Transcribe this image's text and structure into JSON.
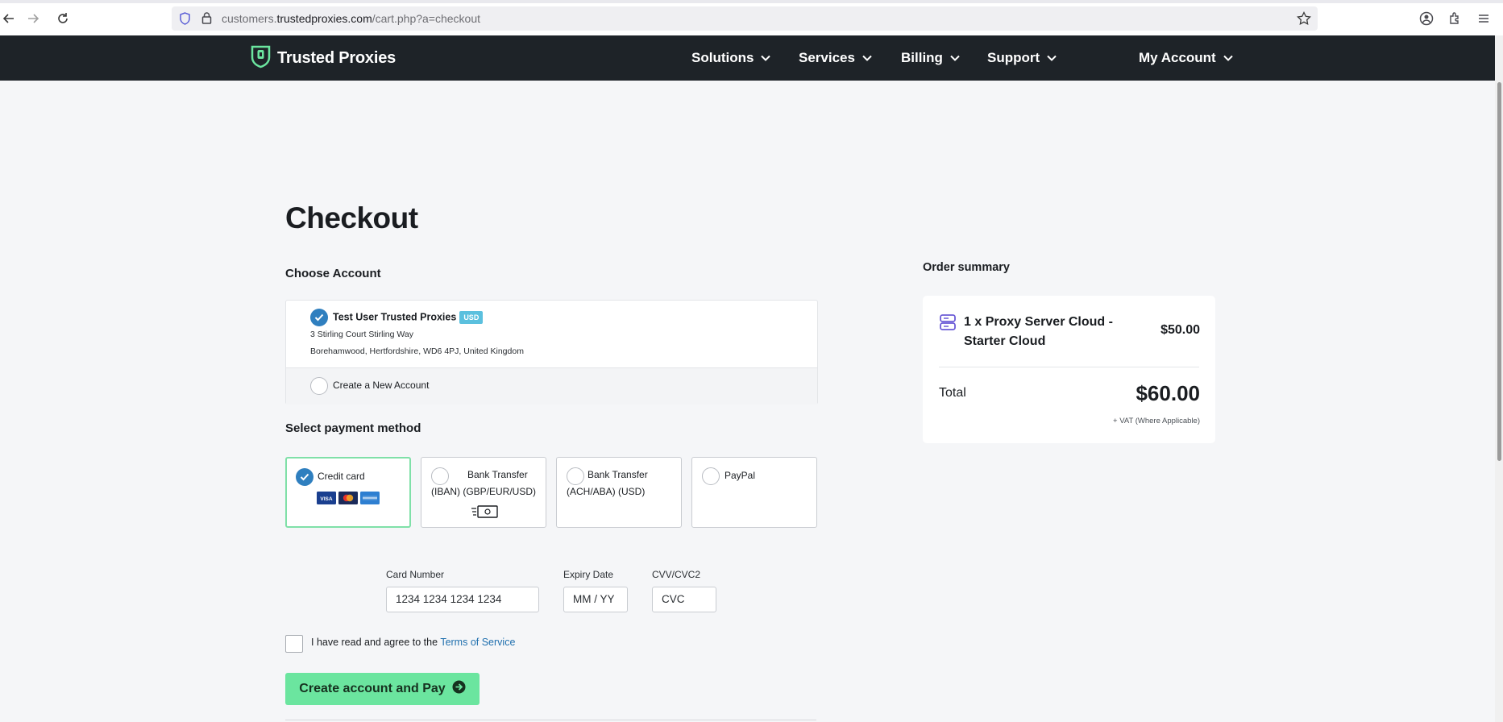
{
  "browser": {
    "url_host_prefix": "customers.",
    "url_host": "trustedproxies.com",
    "url_path": "/cart.php?a=checkout"
  },
  "header": {
    "logo_text": "Trusted Proxies",
    "nav": [
      {
        "label": "Solutions"
      },
      {
        "label": "Services"
      },
      {
        "label": "Billing"
      },
      {
        "label": "Support"
      },
      {
        "label": "My Account"
      }
    ]
  },
  "checkout": {
    "title": "Checkout",
    "choose_account_title": "Choose Account",
    "account": {
      "name": "Test User Trusted Proxies",
      "currency_badge": "USD",
      "address_line1": "3 Stirling Court Stirling Way",
      "address_line2": "Borehamwood, Hertfordshire, WD6 4PJ, United Kingdom",
      "selected": true
    },
    "new_account_label": "Create a New Account",
    "payment_title": "Select payment method",
    "payment_methods": [
      {
        "label": "Credit card",
        "selected": true
      },
      {
        "label_line1": "Bank Transfer",
        "label_line2": "(IBAN) (GBP/EUR/USD)",
        "selected": false
      },
      {
        "label_line1": "Bank Transfer",
        "label_line2": "(ACH/ABA) (USD)",
        "selected": false
      },
      {
        "label": "PayPal",
        "selected": false
      }
    ],
    "card_icons": [
      "visa-icon",
      "mastercard-icon",
      "amex-icon"
    ],
    "fields": {
      "card_number_label": "Card Number",
      "card_number_placeholder": "1234 1234 1234 1234",
      "expiry_label": "Expiry Date",
      "expiry_placeholder": "MM / YY",
      "cvv_label": "CVV/CVC2",
      "cvv_placeholder": "CVC"
    },
    "tos_text": "I have read and agree to the ",
    "tos_link": "Terms of Service",
    "submit_label": "Create account and Pay"
  },
  "summary": {
    "title": "Order summary",
    "item_name": "1 x Proxy Server Cloud - Starter Cloud",
    "item_price": "$50.00",
    "total_label": "Total",
    "total_price": "$60.00",
    "vat_note": "+ VAT (Where Applicable)"
  },
  "colors": {
    "header_bg": "#1e2328",
    "accent_green": "#6be59f",
    "check_blue": "#2f7fbf",
    "badge_blue": "#5bc0de",
    "logo_green": "#6be59f"
  }
}
